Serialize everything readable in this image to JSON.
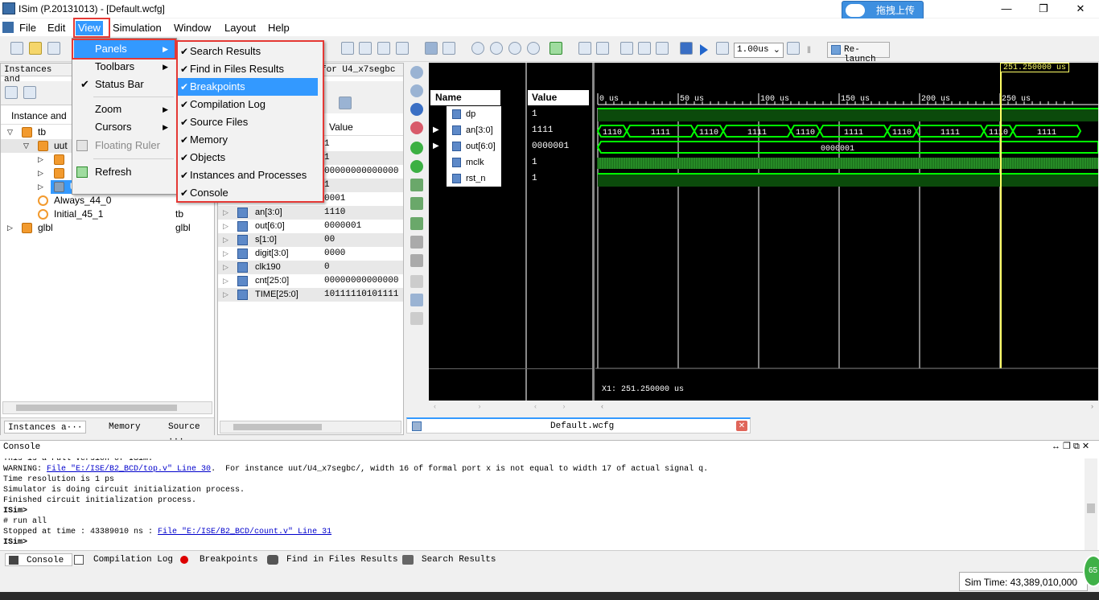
{
  "window": {
    "title": "ISim (P.20131013) - [Default.wcfg]",
    "upload_label": "拖拽上传"
  },
  "menubar": [
    "File",
    "Edit",
    "View",
    "Simulation",
    "Window",
    "Layout",
    "Help"
  ],
  "view_menu": {
    "items": [
      {
        "label": "Panels",
        "submenu": true,
        "highlighted": true
      },
      {
        "label": "Toolbars",
        "submenu": true
      },
      {
        "label": "Status Bar",
        "checked": true
      },
      {
        "label": "Zoom",
        "submenu": true
      },
      {
        "label": "Cursors",
        "submenu": true
      },
      {
        "label": "Floating Ruler",
        "disabled": true
      },
      {
        "label": "Refresh"
      }
    ]
  },
  "panels_menu": {
    "items": [
      "Search Results",
      "Find in Files Results",
      "Breakpoints",
      "Compilation Log",
      "Source Files",
      "Memory",
      "Objects",
      "Instances and Processes",
      "Console"
    ],
    "highlighted": "Breakpoints"
  },
  "toolbar": {
    "zoom_value": "1.00us",
    "relaunch_label": "Re-launch"
  },
  "instances": {
    "header": "Instances and",
    "col1": "Instance and",
    "rows": [
      {
        "name": "tb",
        "indent": 0,
        "expanded": true
      },
      {
        "name": "uut",
        "indent": 1,
        "expanded": true
      },
      {
        "name": "U4_x7segbc",
        "indent": 2,
        "selected": true
      },
      {
        "name": "Always_44_0",
        "indent": 2,
        "col2": ""
      },
      {
        "name": "Initial_45_1",
        "indent": 2,
        "col2": "tb"
      },
      {
        "name": "glbl",
        "indent": 0,
        "col2": "glbl"
      }
    ],
    "tabs": [
      "Instances a···",
      "Memory",
      "Source ···"
    ]
  },
  "objects": {
    "header": "for U4_x7segbc",
    "value_col": "Value",
    "rows": [
      {
        "name": "",
        "value": "1"
      },
      {
        "name": "",
        "value": "1"
      },
      {
        "name": "",
        "value": "00000000000000"
      },
      {
        "name": "",
        "value": "1"
      },
      {
        "name": "",
        "value": "0001"
      },
      {
        "name": "an[3:0]",
        "value": "1110"
      },
      {
        "name": "out[6:0]",
        "value": "0000001"
      },
      {
        "name": "s[1:0]",
        "value": "00"
      },
      {
        "name": "digit[3:0]",
        "value": "0000"
      },
      {
        "name": "clk190",
        "value": "0"
      },
      {
        "name": "cnt[25:0]",
        "value": "00000000000000"
      },
      {
        "name": "TIME[25:0]",
        "value": "10111110101111"
      }
    ]
  },
  "wave": {
    "name_header": "Name",
    "value_header": "Value",
    "cursor_label": "251.250000 us",
    "cursor_readout": "X1: 251.250000 us",
    "tab_label": "Default.wcfg",
    "ticks": [
      "0 us",
      "50 us",
      "100 us",
      "150 us",
      "200 us",
      "250 us"
    ],
    "signals": [
      {
        "name": "dp",
        "value": "1"
      },
      {
        "name": "an[3:0]",
        "value": "1111",
        "expandable": true
      },
      {
        "name": "out[6:0]",
        "value": "0000001",
        "expandable": true
      },
      {
        "name": "mclk",
        "value": "1"
      },
      {
        "name": "rst_n",
        "value": "1"
      }
    ],
    "an_segments": [
      "1110",
      "1111",
      "1110",
      "1111",
      "1110",
      "1111",
      "1110",
      "1111",
      "1110",
      "1111"
    ],
    "out_value": "0000001"
  },
  "console": {
    "header": "Console",
    "lines": [
      {
        "text": "This is a Full version of ISim."
      },
      {
        "pre": "WARNING: ",
        "link": "File \"E:/ISE/B2_BCD/top.v\" Line 30",
        "post": ".  For instance uut/U4_x7segbc/, width 16 of formal port x is not equal to width 17 of actual signal q."
      },
      {
        "text": "Time resolution is 1 ps"
      },
      {
        "text": "Simulator is doing circuit initialization process."
      },
      {
        "text": "Finished circuit initialization process."
      },
      {
        "text": "ISim>",
        "bold": true
      },
      {
        "text": "# run all"
      },
      {
        "pre": "Stopped at time : 43389010 ns : ",
        "link": "File \"E:/ISE/B2_BCD/count.v\" Line 31",
        "post": ""
      },
      {
        "text": "ISim>",
        "bold": true
      }
    ]
  },
  "bottom_tabs": [
    "Console",
    "Compilation Log",
    "Breakpoints",
    "Find in Files Results",
    "Search Results"
  ],
  "status": {
    "sim_time": "Sim Time: 43,389,010,000"
  },
  "badge": "65",
  "colors": {
    "accent": "#3399ff",
    "wave_green": "#00ff00",
    "cursor_yellow": "#ffff66",
    "highlight_red": "#e53935"
  }
}
